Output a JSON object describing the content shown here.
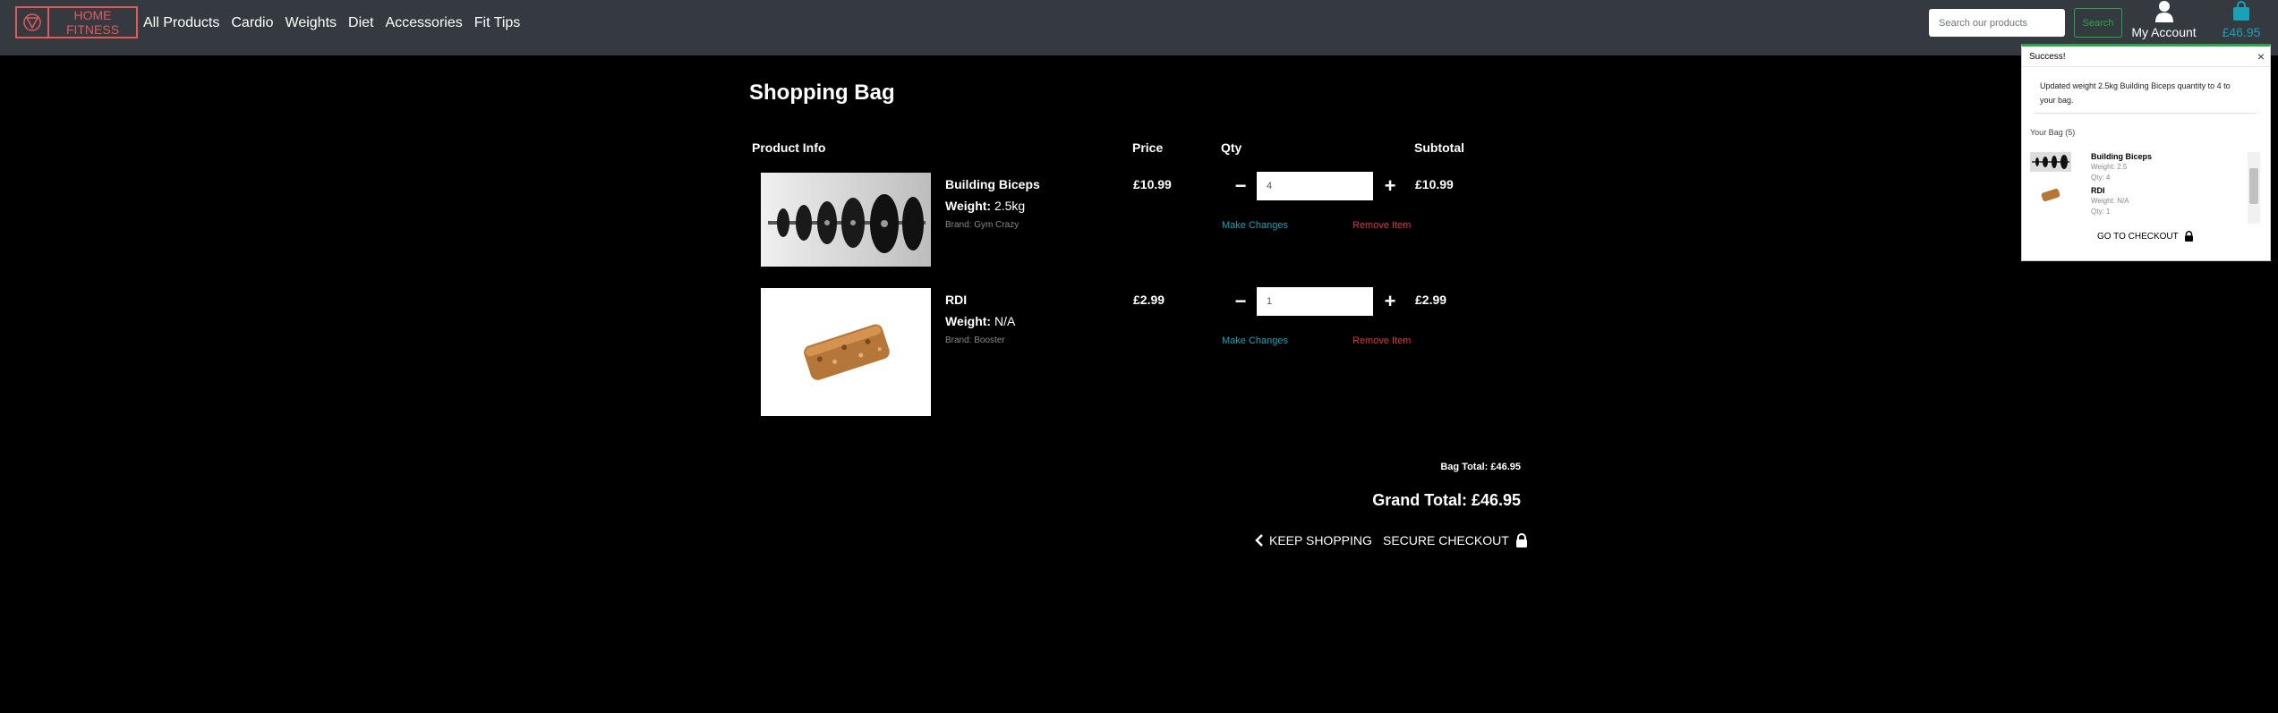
{
  "brand": {
    "name": "HOME FITNESS"
  },
  "nav": {
    "links": [
      "All Products",
      "Cardio",
      "Weights",
      "Diet",
      "Accessories",
      "Fit Tips"
    ]
  },
  "search": {
    "placeholder": "Search our products",
    "button": "Search"
  },
  "account": {
    "label": "My Account"
  },
  "bag_link": {
    "total": "£46.95"
  },
  "page": {
    "title": "Shopping Bag",
    "headers": {
      "product": "Product Info",
      "price": "Price",
      "qty": "Qty",
      "subtotal": "Subtotal"
    },
    "items": [
      {
        "name": "Building Biceps",
        "weight_label": "Weight:",
        "weight": "2.5kg",
        "brand": "Brand: Gym Crazy",
        "price": "£10.99",
        "qty": "4",
        "subtotal": "£10.99",
        "make_changes": "Make Changes",
        "remove": "Remove Item"
      },
      {
        "name": "RDI",
        "weight_label": "Weight:",
        "weight": "N/A",
        "brand": "Brand: Booster",
        "price": "£2.99",
        "qty": "1",
        "subtotal": "£2.99",
        "make_changes": "Make Changes",
        "remove": "Remove Item"
      }
    ],
    "bag_total": "Bag Total: £46.95",
    "grand_total": "Grand Total: £46.95",
    "keep_shopping": "KEEP SHOPPING",
    "secure_checkout": "SECURE CHECKOUT"
  },
  "toast": {
    "title": "Success!",
    "close": "×",
    "message": "Updated weight 2.5kg Building Biceps quantity to 4 to your bag.",
    "bag_count": "Your Bag (5)",
    "items": [
      {
        "name": "Building Biceps",
        "weight": "Weight: 2.5",
        "qty": "Qty: 4"
      },
      {
        "name": "RDI",
        "weight": "Weight: N/A",
        "qty": "Qty: 1"
      }
    ],
    "checkout": "GO TO CHECKOUT"
  },
  "colors": {
    "navbar": "#343a40",
    "brand": "#e05a5a",
    "accent": "#17a2b8",
    "danger": "#dc3545",
    "success": "#28a745"
  }
}
